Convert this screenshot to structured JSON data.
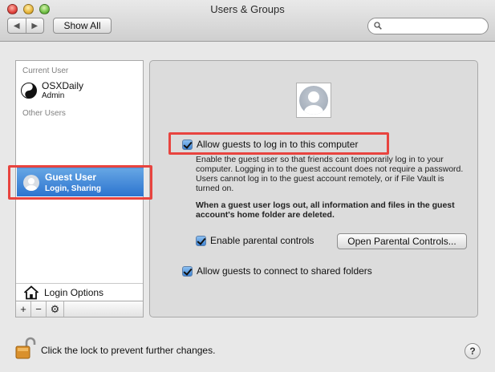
{
  "window": {
    "title": "Users & Groups"
  },
  "toolbar": {
    "back_glyph": "◀",
    "forward_glyph": "▶",
    "show_all_label": "Show All",
    "search_value": ""
  },
  "sidebar": {
    "current_user_heading": "Current User",
    "current_user": {
      "name": "OSXDaily",
      "role": "Admin"
    },
    "other_users_heading": "Other Users",
    "guest_user": {
      "name": "Guest User",
      "detail": "Login, Sharing",
      "selected": true
    },
    "login_options_label": "Login Options",
    "add_glyph": "+",
    "remove_glyph": "−",
    "action_glyph": "⚙"
  },
  "main": {
    "allow_guests": {
      "label": "Allow guests to log in to this computer",
      "checked": true
    },
    "allow_guests_description": "Enable the guest user so that friends can temporarily log in to your computer. Logging in to the guest account does not require a password. Users cannot log in to the guest account remotely, or if File Vault is turned on.",
    "logout_warning": "When a guest user logs out, all information and files in the guest account's home folder are deleted.",
    "parental_controls": {
      "label": "Enable parental controls",
      "checked": true
    },
    "open_parental_controls_label": "Open Parental Controls...",
    "shared_folders": {
      "label": "Allow guests to connect to shared folders",
      "checked": true
    }
  },
  "footer": {
    "lock_text": "Click the lock to prevent further changes.",
    "help_glyph": "?"
  },
  "colors": {
    "highlight_box": "#e8443f",
    "selection": "#2c74cf"
  }
}
